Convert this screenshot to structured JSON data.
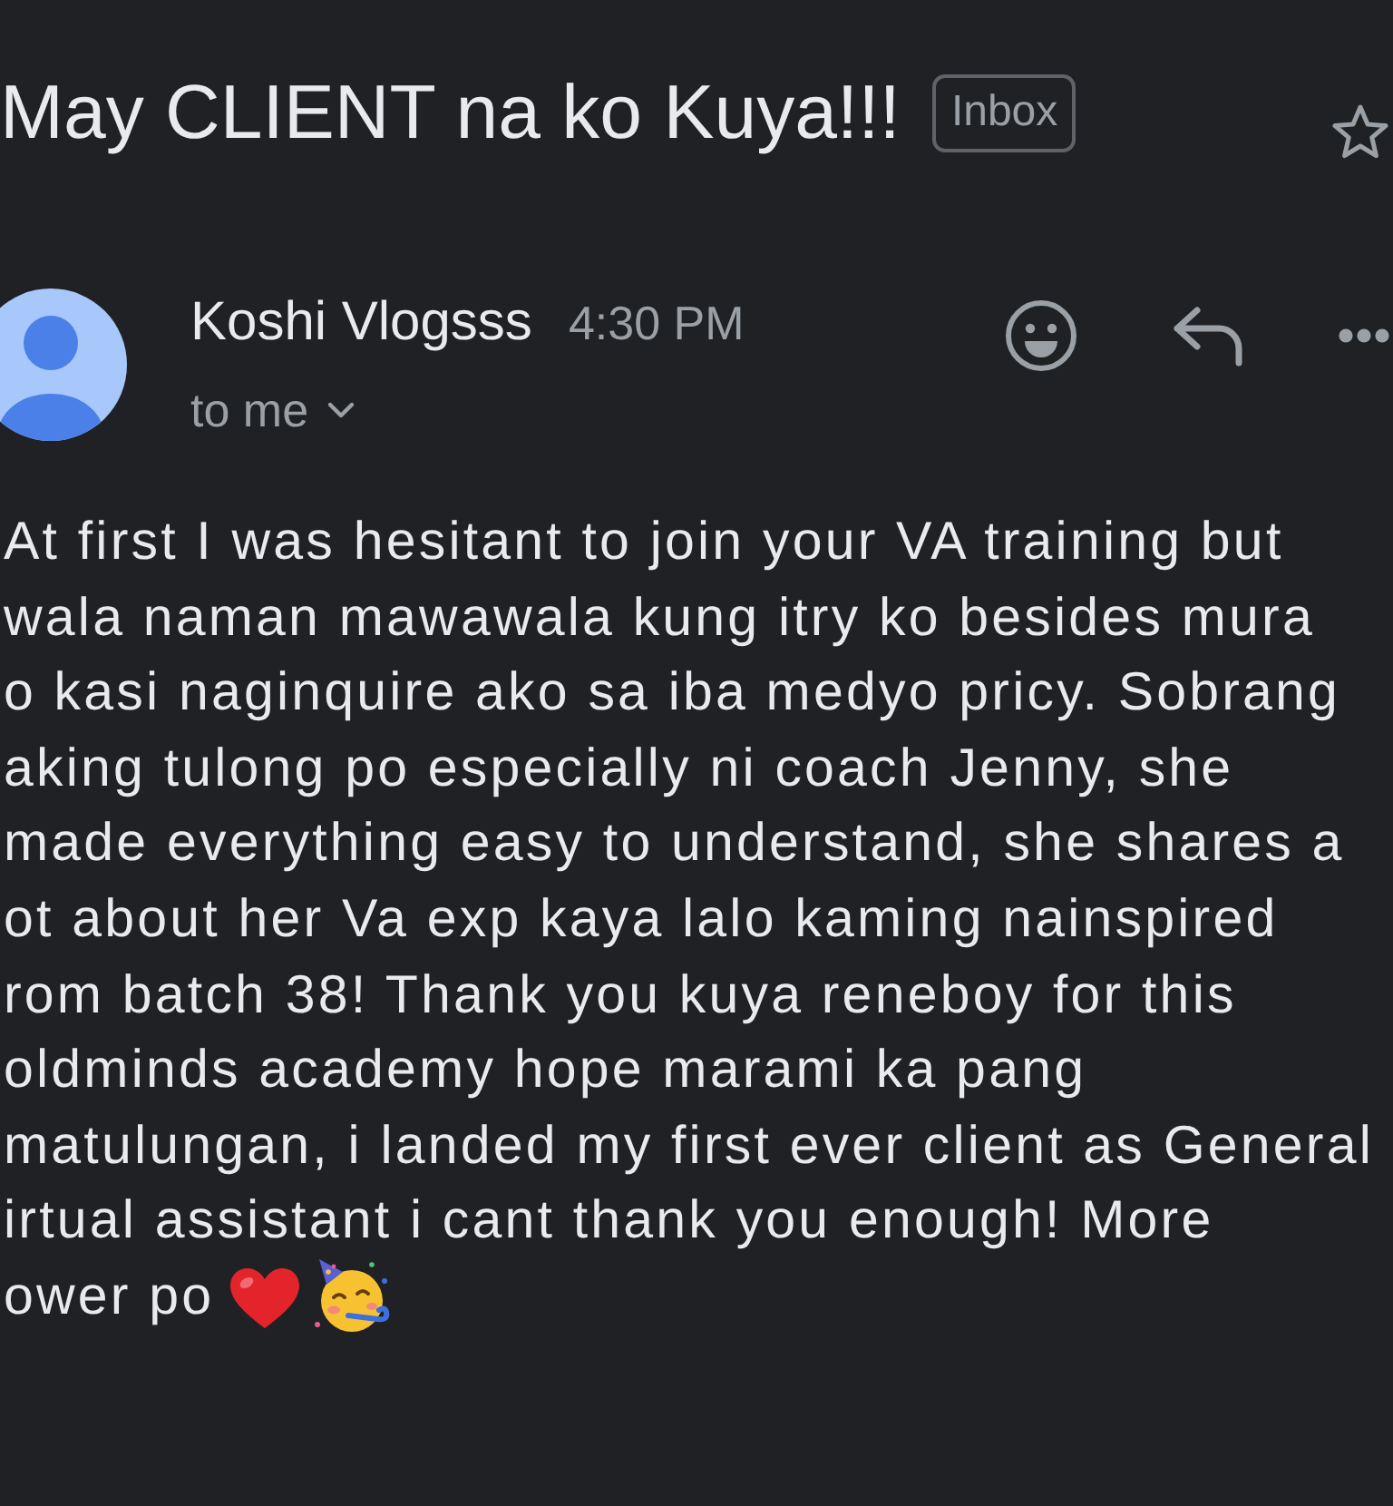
{
  "message": {
    "subject": "May CLIENT na ko Kuya!!!",
    "label": "Inbox",
    "starred": false
  },
  "sender": {
    "name": "Koshi Vlogsss",
    "time": "4:30 PM",
    "recipient": "to me"
  },
  "body": {
    "text": "At first I was hesitant to join your VA training but\nwala naman mawawala kung itry ko besides mura\no kasi naginquire ako sa iba medyo pricy. Sobrang\naking tulong po especially ni coach Jenny, she\nmade everything easy to understand, she shares a\not about her Va exp kaya lalo kaming nainspired\nrom batch 38! Thank you kuya reneboy for this\noldminds academy hope marami ka pang\nmatulungan, i landed my first ever client as General\nirtual assistant i cant thank you enough! More",
    "closing": "ower po"
  }
}
